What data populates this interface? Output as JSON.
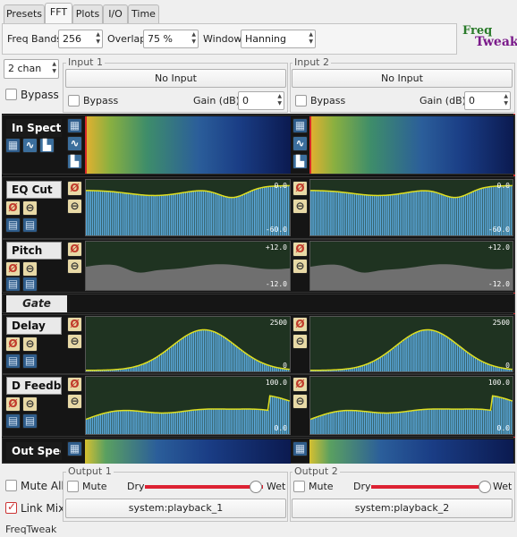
{
  "tabs": [
    "Presets",
    "FFT",
    "Plots",
    "I/O",
    "Time"
  ],
  "fft": {
    "bands_label": "Freq Bands",
    "bands_value": "256",
    "overlap_label": "Overlap",
    "overlap_value": "75 %",
    "window_label": "Window",
    "window_value": "Hanning"
  },
  "logo": {
    "line1": "Freq",
    "line2": "Tweak"
  },
  "channels": "2 chan",
  "bypass_all": "Bypass",
  "inputs": [
    {
      "title": "Input 1",
      "source": "No Input",
      "bypass": "Bypass",
      "gain_label": "Gain (dB)",
      "gain_value": "0"
    },
    {
      "title": "Input 2",
      "source": "No Input",
      "bypass": "Bypass",
      "gain_label": "Gain (dB)",
      "gain_value": "0"
    }
  ],
  "sections": {
    "in_spectrum": "In Spectr",
    "eq_cut": "EQ Cut",
    "eq_top": "0.0",
    "eq_bottom": "-60.0",
    "pitch": "Pitch",
    "pitch_top": "+12.0",
    "pitch_bottom": "-12.0",
    "gate": "Gate",
    "delay": "Delay",
    "delay_top": "2500",
    "delay_bottom": "0",
    "feedback": "D Feedb",
    "fb_top": "100.0",
    "fb_bottom": "0.0",
    "out_spectrum": "Out Spec"
  },
  "mute_all": "Mute All",
  "link_mix": "Link Mix",
  "outputs": [
    {
      "title": "Output 1",
      "mute": "Mute",
      "dry": "Dry",
      "wet": "Wet",
      "mix": 0.94,
      "port": "system:playback_1"
    },
    {
      "title": "Output 2",
      "mute": "Mute",
      "dry": "Dry",
      "wet": "Wet",
      "mix": 0.96,
      "port": "system:playback_2"
    }
  ],
  "status": "FreqTweak",
  "colors": {
    "accent": "#d62a2a",
    "bar": "#5aa9dc",
    "curve": "#e0e020",
    "plotbg": "#1f3321"
  }
}
